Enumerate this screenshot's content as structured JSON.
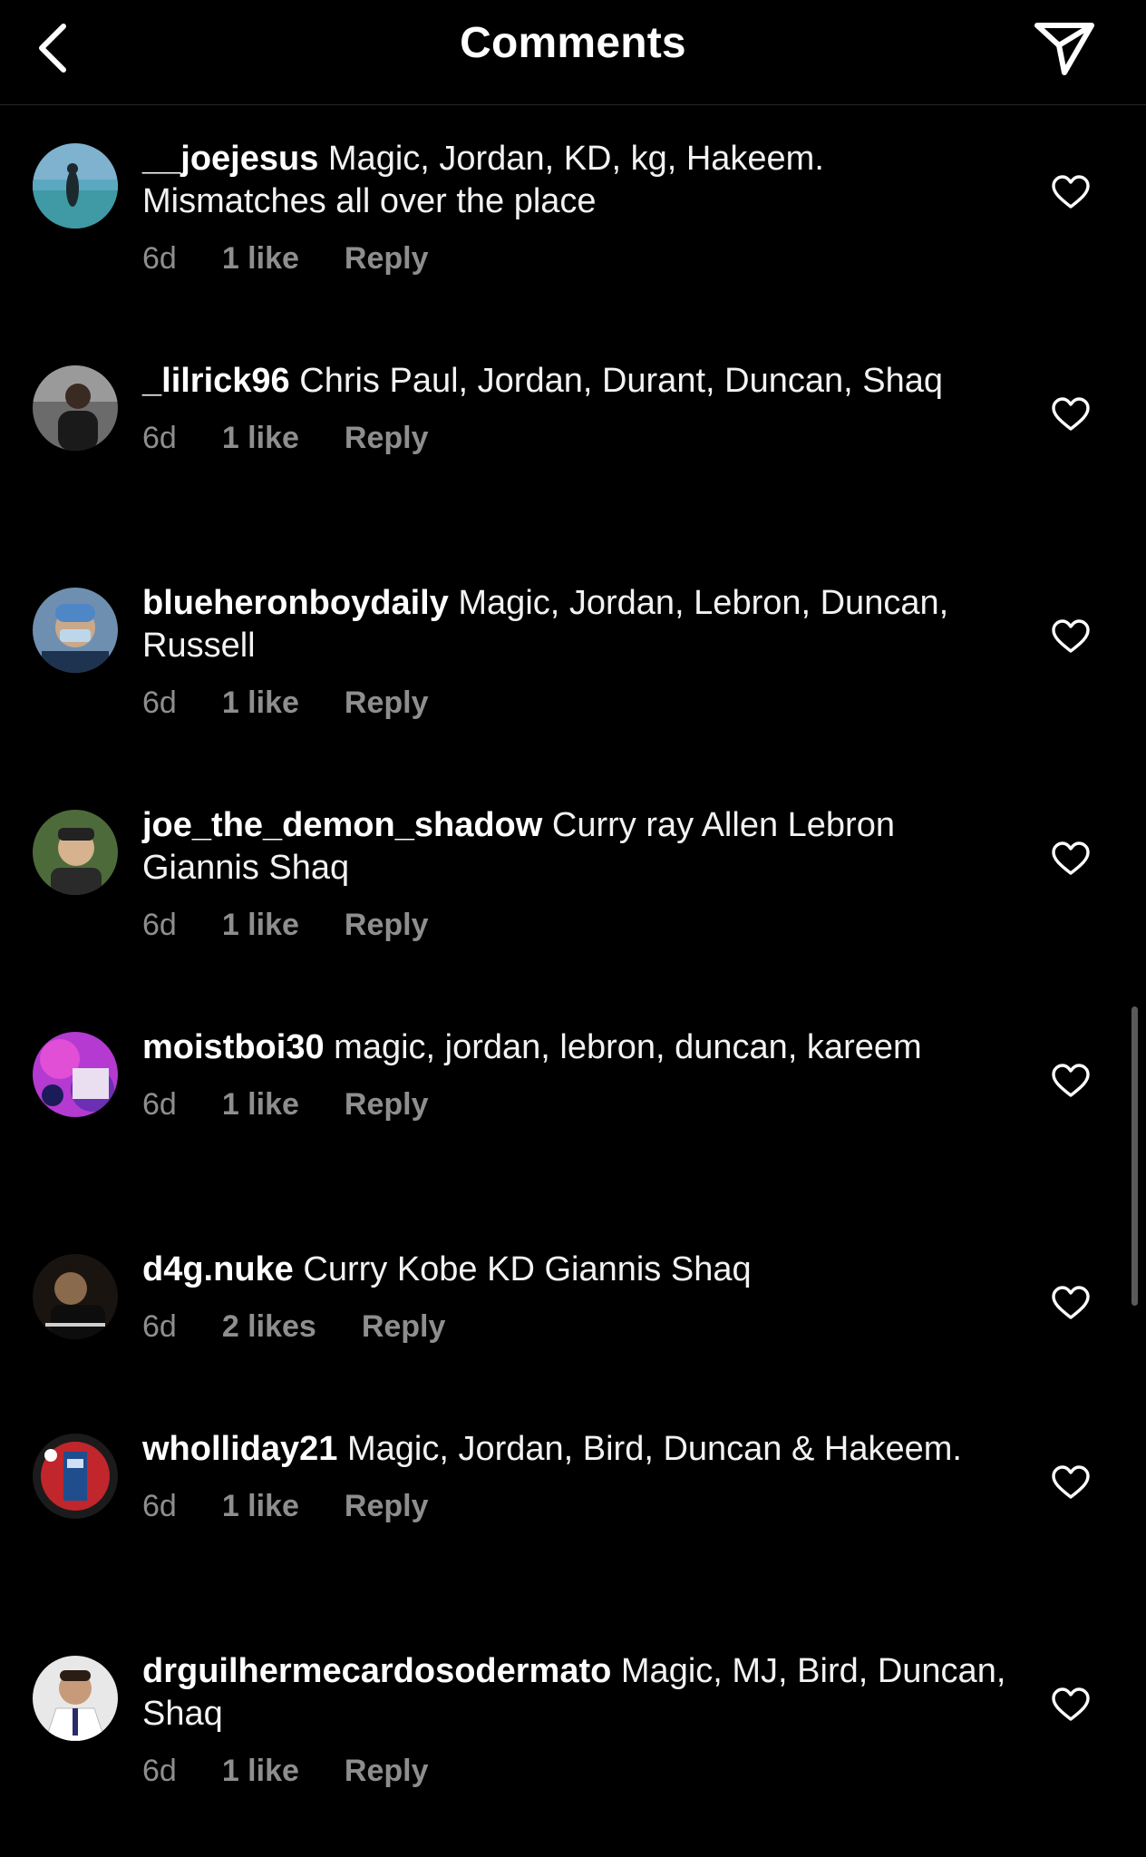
{
  "header": {
    "title": "Comments",
    "back_icon": "chevron-left-icon",
    "share_icon": "paper-plane-icon"
  },
  "comments": [
    {
      "username": "__joejesus",
      "text": "Magic, Jordan, KD, kg, Hakeem. Mismatches all over the place",
      "time": "6d",
      "likes": "1 like",
      "reply": "Reply"
    },
    {
      "username": "_lilrick96",
      "text": "Chris Paul, Jordan, Durant, Duncan, Shaq",
      "time": "6d",
      "likes": "1 like",
      "reply": "Reply"
    },
    {
      "username": "blueheronboydaily",
      "text": "Magic, Jordan, Lebron, Duncan, Russell",
      "time": "6d",
      "likes": "1 like",
      "reply": "Reply"
    },
    {
      "username": "joe_the_demon_shadow",
      "text": "Curry  ray Allen Lebron Giannis  Shaq",
      "time": "6d",
      "likes": "1 like",
      "reply": "Reply"
    },
    {
      "username": "moistboi30",
      "text": "magic, jordan, lebron, duncan, kareem",
      "time": "6d",
      "likes": "1 like",
      "reply": "Reply"
    },
    {
      "username": "d4g.nuke",
      "text": "Curry Kobe KD Giannis Shaq",
      "time": "6d",
      "likes": "2 likes",
      "reply": "Reply"
    },
    {
      "username": "wholliday21",
      "text": "Magic, Jordan, Bird, Duncan & Hakeem.",
      "time": "6d",
      "likes": "1 like",
      "reply": "Reply"
    },
    {
      "username": "drguilhermecardosodermato",
      "text": "Magic, MJ, Bird, Duncan, Shaq",
      "time": "6d",
      "likes": "1 like",
      "reply": "Reply"
    }
  ],
  "colors": {
    "background": "#000000",
    "text": "#ffffff",
    "secondary_text": "#8e8e8e"
  }
}
